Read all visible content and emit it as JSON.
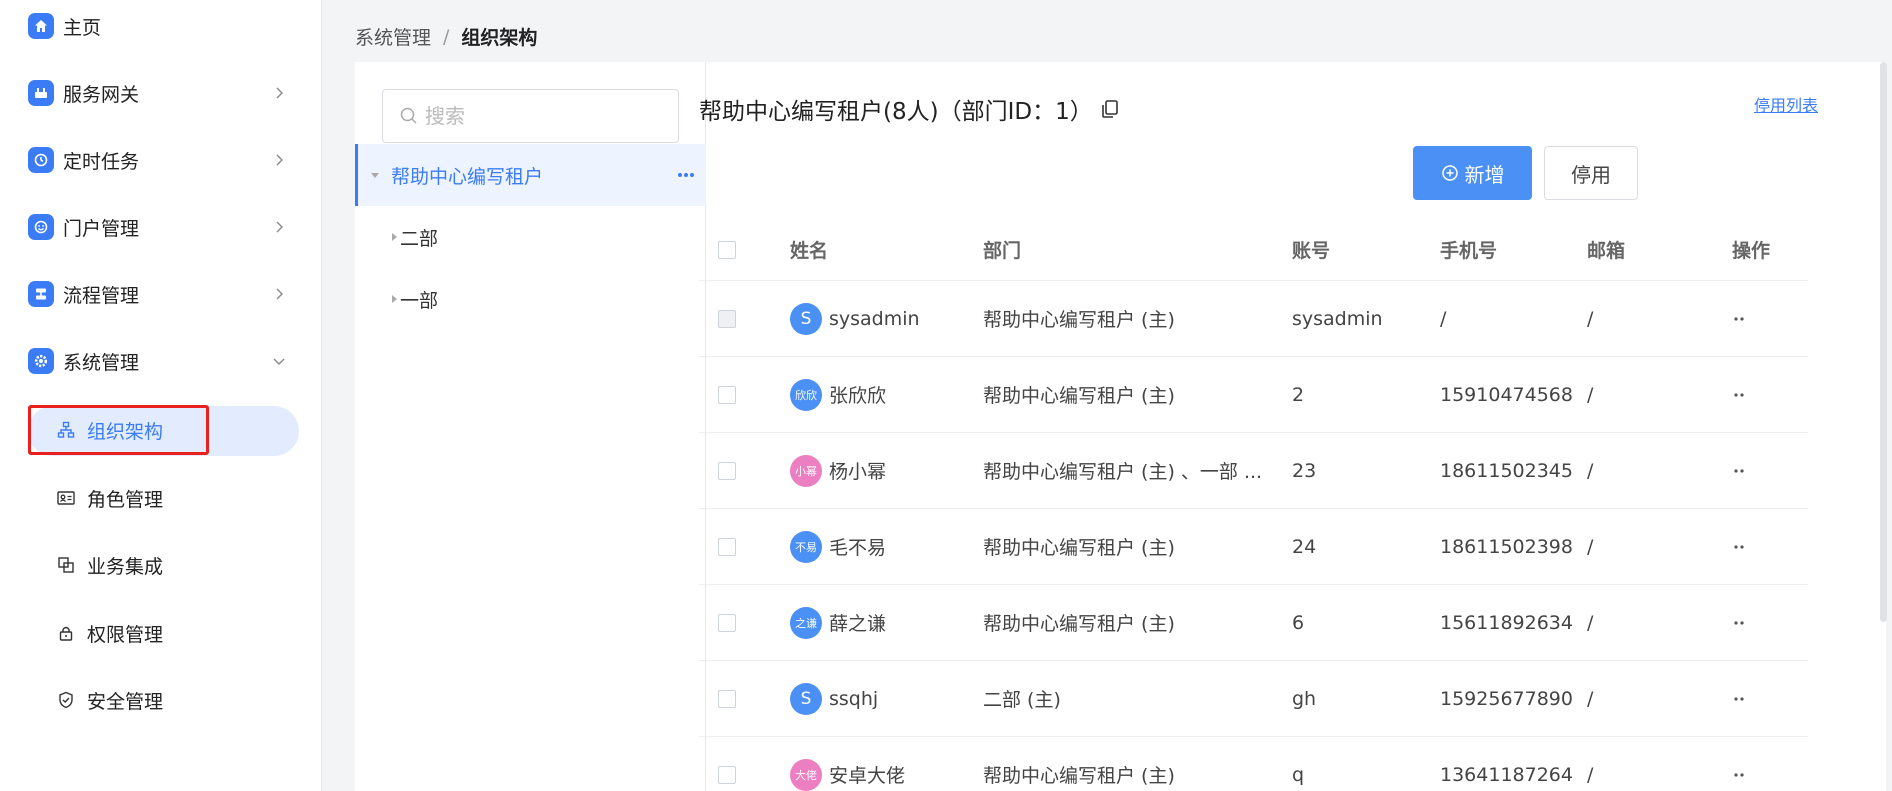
{
  "sidebar": {
    "items": [
      {
        "label": "主页",
        "icon": "home-icon",
        "has_chevron": false
      },
      {
        "label": "服务网关",
        "icon": "gateway-icon",
        "has_chevron": true
      },
      {
        "label": "定时任务",
        "icon": "clock-icon",
        "has_chevron": true
      },
      {
        "label": "门户管理",
        "icon": "portal-icon",
        "has_chevron": true
      },
      {
        "label": "流程管理",
        "icon": "flow-icon",
        "has_chevron": true
      },
      {
        "label": "系统管理",
        "icon": "gear-icon",
        "has_chevron": true,
        "expanded": true
      }
    ],
    "sub_items": [
      {
        "label": "组织架构",
        "icon": "org-chart-icon",
        "active": true
      },
      {
        "label": "角色管理",
        "icon": "id-card-icon"
      },
      {
        "label": "业务集成",
        "icon": "integration-icon"
      },
      {
        "label": "权限管理",
        "icon": "lock-icon"
      },
      {
        "label": "安全管理",
        "icon": "shield-icon"
      }
    ]
  },
  "breadcrumb": {
    "parent": "系统管理",
    "separator": "/",
    "current": "组织架构"
  },
  "tree": {
    "search_placeholder": "搜索",
    "nodes": [
      {
        "label": "帮助中心编写租户",
        "selected": true
      },
      {
        "label": "二部"
      },
      {
        "label": "一部"
      }
    ]
  },
  "detail": {
    "title": "帮助中心编写租户(8人)（部门ID：1）",
    "disabled_list_link": "停用列表",
    "add_button": "新增",
    "disable_button": "停用"
  },
  "table": {
    "headers": {
      "name": "姓名",
      "dept": "部门",
      "account": "账号",
      "phone": "手机号",
      "email": "邮箱",
      "ops": "操作"
    },
    "rows": [
      {
        "avatar_text": "S",
        "avatar_color": "#4a90f5",
        "name": "sysadmin",
        "dept": "帮助中心编写租户 (主)",
        "account": "sysadmin",
        "phone": "/",
        "email": "/",
        "checkbox_disabled": true
      },
      {
        "avatar_text": "欣欣",
        "avatar_color": "#4a90f5",
        "name": "张欣欣",
        "dept": "帮助中心编写租户 (主)",
        "account": "2",
        "phone": "15910474568",
        "email": "/"
      },
      {
        "avatar_text": "小幂",
        "avatar_color": "#ec7fc2",
        "name": "杨小幂",
        "dept": "帮助中心编写租户 (主) 、一部 ...",
        "account": "23",
        "phone": "18611502345",
        "email": "/"
      },
      {
        "avatar_text": "不易",
        "avatar_color": "#4a90f5",
        "name": "毛不易",
        "dept": "帮助中心编写租户 (主)",
        "account": "24",
        "phone": "18611502398",
        "email": "/"
      },
      {
        "avatar_text": "之谦",
        "avatar_color": "#4a90f5",
        "name": "薛之谦",
        "dept": "帮助中心编写租户 (主)",
        "account": "6",
        "phone": "15611892634",
        "email": "/"
      },
      {
        "avatar_text": "S",
        "avatar_color": "#4a90f5",
        "name": "ssqhj",
        "dept": "二部 (主)",
        "account": "gh",
        "phone": "15925677890",
        "email": "/"
      },
      {
        "avatar_text": "大佬",
        "avatar_color": "#ec7fc2",
        "name": "安卓大佬",
        "dept": "帮助中心编写租户 (主)",
        "account": "q",
        "phone": "13641187264",
        "email": "/"
      }
    ]
  },
  "colors": {
    "accent": "#3b7cf6",
    "highlight_outline": "#e8201e",
    "active_bg": "#e3ecff"
  }
}
